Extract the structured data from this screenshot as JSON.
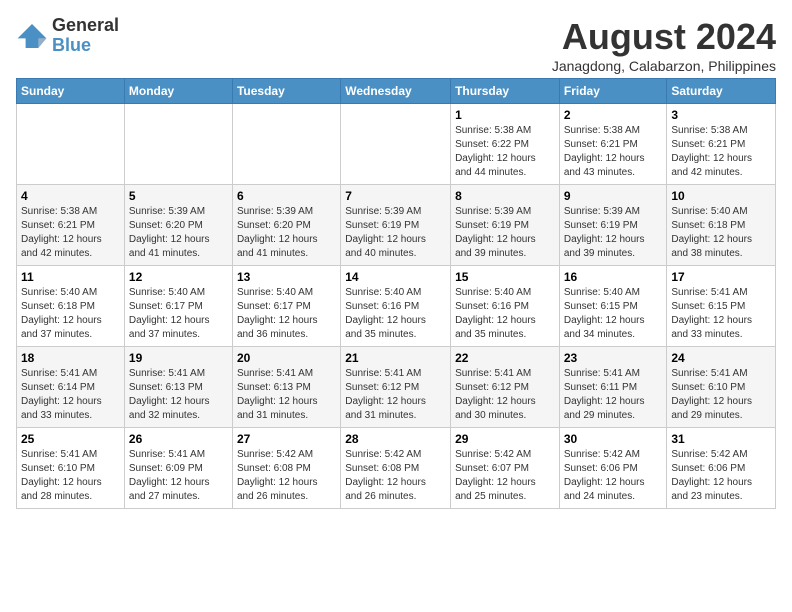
{
  "logo": {
    "general": "General",
    "blue": "Blue"
  },
  "title": {
    "month_year": "August 2024",
    "location": "Janagdong, Calabarzon, Philippines"
  },
  "weekdays": [
    "Sunday",
    "Monday",
    "Tuesday",
    "Wednesday",
    "Thursday",
    "Friday",
    "Saturday"
  ],
  "weeks": [
    [
      {
        "day": "",
        "info": ""
      },
      {
        "day": "",
        "info": ""
      },
      {
        "day": "",
        "info": ""
      },
      {
        "day": "",
        "info": ""
      },
      {
        "day": "1",
        "info": "Sunrise: 5:38 AM\nSunset: 6:22 PM\nDaylight: 12 hours\nand 44 minutes."
      },
      {
        "day": "2",
        "info": "Sunrise: 5:38 AM\nSunset: 6:21 PM\nDaylight: 12 hours\nand 43 minutes."
      },
      {
        "day": "3",
        "info": "Sunrise: 5:38 AM\nSunset: 6:21 PM\nDaylight: 12 hours\nand 42 minutes."
      }
    ],
    [
      {
        "day": "4",
        "info": "Sunrise: 5:38 AM\nSunset: 6:21 PM\nDaylight: 12 hours\nand 42 minutes."
      },
      {
        "day": "5",
        "info": "Sunrise: 5:39 AM\nSunset: 6:20 PM\nDaylight: 12 hours\nand 41 minutes."
      },
      {
        "day": "6",
        "info": "Sunrise: 5:39 AM\nSunset: 6:20 PM\nDaylight: 12 hours\nand 41 minutes."
      },
      {
        "day": "7",
        "info": "Sunrise: 5:39 AM\nSunset: 6:19 PM\nDaylight: 12 hours\nand 40 minutes."
      },
      {
        "day": "8",
        "info": "Sunrise: 5:39 AM\nSunset: 6:19 PM\nDaylight: 12 hours\nand 39 minutes."
      },
      {
        "day": "9",
        "info": "Sunrise: 5:39 AM\nSunset: 6:19 PM\nDaylight: 12 hours\nand 39 minutes."
      },
      {
        "day": "10",
        "info": "Sunrise: 5:40 AM\nSunset: 6:18 PM\nDaylight: 12 hours\nand 38 minutes."
      }
    ],
    [
      {
        "day": "11",
        "info": "Sunrise: 5:40 AM\nSunset: 6:18 PM\nDaylight: 12 hours\nand 37 minutes."
      },
      {
        "day": "12",
        "info": "Sunrise: 5:40 AM\nSunset: 6:17 PM\nDaylight: 12 hours\nand 37 minutes."
      },
      {
        "day": "13",
        "info": "Sunrise: 5:40 AM\nSunset: 6:17 PM\nDaylight: 12 hours\nand 36 minutes."
      },
      {
        "day": "14",
        "info": "Sunrise: 5:40 AM\nSunset: 6:16 PM\nDaylight: 12 hours\nand 35 minutes."
      },
      {
        "day": "15",
        "info": "Sunrise: 5:40 AM\nSunset: 6:16 PM\nDaylight: 12 hours\nand 35 minutes."
      },
      {
        "day": "16",
        "info": "Sunrise: 5:40 AM\nSunset: 6:15 PM\nDaylight: 12 hours\nand 34 minutes."
      },
      {
        "day": "17",
        "info": "Sunrise: 5:41 AM\nSunset: 6:15 PM\nDaylight: 12 hours\nand 33 minutes."
      }
    ],
    [
      {
        "day": "18",
        "info": "Sunrise: 5:41 AM\nSunset: 6:14 PM\nDaylight: 12 hours\nand 33 minutes."
      },
      {
        "day": "19",
        "info": "Sunrise: 5:41 AM\nSunset: 6:13 PM\nDaylight: 12 hours\nand 32 minutes."
      },
      {
        "day": "20",
        "info": "Sunrise: 5:41 AM\nSunset: 6:13 PM\nDaylight: 12 hours\nand 31 minutes."
      },
      {
        "day": "21",
        "info": "Sunrise: 5:41 AM\nSunset: 6:12 PM\nDaylight: 12 hours\nand 31 minutes."
      },
      {
        "day": "22",
        "info": "Sunrise: 5:41 AM\nSunset: 6:12 PM\nDaylight: 12 hours\nand 30 minutes."
      },
      {
        "day": "23",
        "info": "Sunrise: 5:41 AM\nSunset: 6:11 PM\nDaylight: 12 hours\nand 29 minutes."
      },
      {
        "day": "24",
        "info": "Sunrise: 5:41 AM\nSunset: 6:10 PM\nDaylight: 12 hours\nand 29 minutes."
      }
    ],
    [
      {
        "day": "25",
        "info": "Sunrise: 5:41 AM\nSunset: 6:10 PM\nDaylight: 12 hours\nand 28 minutes."
      },
      {
        "day": "26",
        "info": "Sunrise: 5:41 AM\nSunset: 6:09 PM\nDaylight: 12 hours\nand 27 minutes."
      },
      {
        "day": "27",
        "info": "Sunrise: 5:42 AM\nSunset: 6:08 PM\nDaylight: 12 hours\nand 26 minutes."
      },
      {
        "day": "28",
        "info": "Sunrise: 5:42 AM\nSunset: 6:08 PM\nDaylight: 12 hours\nand 26 minutes."
      },
      {
        "day": "29",
        "info": "Sunrise: 5:42 AM\nSunset: 6:07 PM\nDaylight: 12 hours\nand 25 minutes."
      },
      {
        "day": "30",
        "info": "Sunrise: 5:42 AM\nSunset: 6:06 PM\nDaylight: 12 hours\nand 24 minutes."
      },
      {
        "day": "31",
        "info": "Sunrise: 5:42 AM\nSunset: 6:06 PM\nDaylight: 12 hours\nand 23 minutes."
      }
    ]
  ]
}
